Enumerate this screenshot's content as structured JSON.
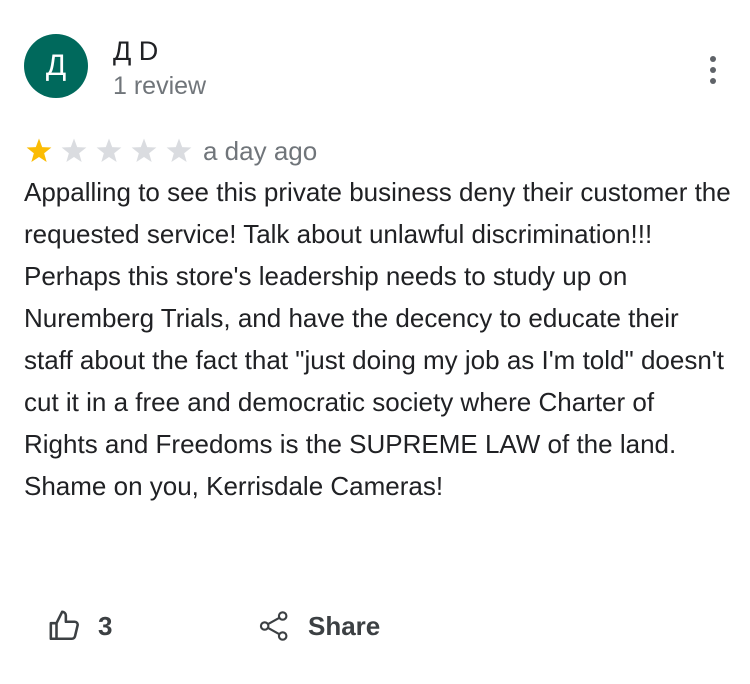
{
  "review": {
    "author": {
      "avatar_letter": "Д",
      "avatar_color": "#00695c",
      "name": "Д D",
      "review_count": "1 review"
    },
    "rating": {
      "value": 1,
      "max": 5,
      "filled_color": "#fbbc04",
      "empty_color": "#dadce0"
    },
    "timestamp": "a day ago",
    "text": "Appalling to see this private business deny their customer the requested service! Talk about unlawful discrimination!!! Perhaps this store's leadership needs to study up on Nuremberg Trials, and have the decency to educate their staff about the fact that \"just doing my job as I'm told\" doesn't cut it in a free and democratic society where Charter of Rights and Freedoms is the SUPREME LAW of the land. Shame on you, Kerrisdale Cameras!",
    "actions": {
      "like_count": "3",
      "share_label": "Share"
    },
    "icons": {
      "menu": "more-vert-icon",
      "like": "thumb-up-icon",
      "share": "share-icon",
      "star": "star-icon"
    }
  }
}
